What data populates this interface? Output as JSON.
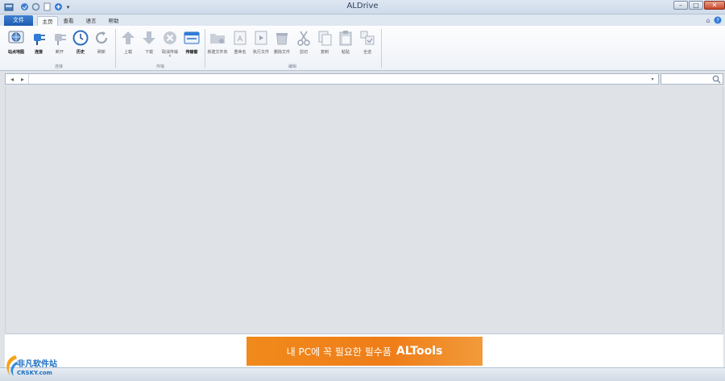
{
  "window": {
    "title": "ALDrive"
  },
  "quick_access": [
    "app-icon",
    "save-icon",
    "refresh-icon",
    "document-icon",
    "add-icon",
    "customize-dropdown-icon"
  ],
  "tabs": {
    "file": "文件",
    "items": [
      "主页",
      "查看",
      "语言",
      "帮助"
    ],
    "active": 0
  },
  "ribbon": {
    "groups": [
      {
        "label": "连接",
        "buttons": [
          {
            "label": "站点地图",
            "icon": "site-map-icon",
            "enabled": true
          },
          {
            "label": "连接",
            "icon": "connect-plug-icon",
            "enabled": true
          },
          {
            "label": "断开",
            "icon": "disconnect-plug-icon",
            "enabled": false
          },
          {
            "label": "历史",
            "icon": "history-clock-icon",
            "enabled": true
          },
          {
            "label": "刷新",
            "icon": "refresh-icon",
            "enabled": false
          }
        ]
      },
      {
        "label": "传输",
        "buttons": [
          {
            "label": "上载",
            "icon": "upload-arrow-icon",
            "enabled": false
          },
          {
            "label": "下载",
            "icon": "download-arrow-icon",
            "enabled": false
          },
          {
            "label": "取消传输",
            "icon": "cancel-transfer-icon",
            "enabled": false,
            "dropdown": true
          },
          {
            "label": "传输窗",
            "icon": "transfer-window-icon",
            "enabled": true
          }
        ]
      },
      {
        "label": "编辑",
        "buttons": [
          {
            "label": "新建文件夹",
            "icon": "new-folder-icon",
            "enabled": false
          },
          {
            "label": "重命名",
            "icon": "rename-icon",
            "enabled": false
          },
          {
            "label": "执行文件",
            "icon": "execute-file-icon",
            "enabled": false
          },
          {
            "label": "删除文件",
            "icon": "delete-file-icon",
            "enabled": false
          },
          {
            "label": "剪切",
            "icon": "cut-icon",
            "enabled": false
          },
          {
            "label": "复制",
            "icon": "copy-icon",
            "enabled": false
          },
          {
            "label": "粘贴",
            "icon": "paste-icon",
            "enabled": false
          },
          {
            "label": "全选",
            "icon": "select-all-icon",
            "enabled": false
          }
        ]
      }
    ]
  },
  "address_bar": {
    "value": ""
  },
  "search": {
    "value": ""
  },
  "ad_banner": {
    "text": "내 PC에 꼭 필요한 필수품",
    "brand": "ALTools"
  },
  "watermark": {
    "text": "非凡软件站",
    "sub": "CRSKY.com"
  },
  "colors": {
    "accent": "#1d5bb0",
    "banner": "#ef7d18"
  }
}
